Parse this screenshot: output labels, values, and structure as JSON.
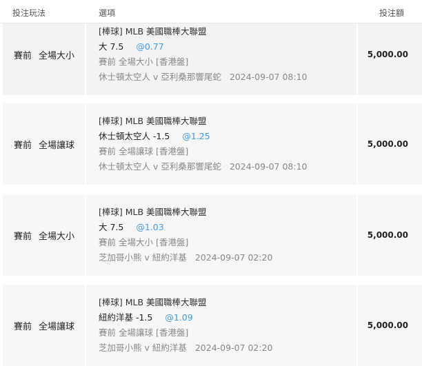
{
  "header": {
    "type_col": "投注玩法",
    "option_col": "選項",
    "amount_col": "投注額"
  },
  "bets": [
    {
      "phase": "賽前",
      "market": "全場大小",
      "league": "[棒球] MLB 美國職棒大聯盟",
      "selection": "大 7.5",
      "odds": "@0.77",
      "meta": "賽前 全場大小 [香港盤]",
      "match": "休士頓太空人 v 亞利桑那響尾蛇",
      "time": "2024-09-07 08:10",
      "amount": "5,000.00"
    },
    {
      "phase": "賽前",
      "market": "全場讓球",
      "league": "[棒球] MLB 美國職棒大聯盟",
      "selection": "休士頓太空人 -1.5",
      "odds": "@1.25",
      "meta": "賽前 全場讓球 [香港盤]",
      "match": "休士頓太空人 v 亞利桑那響尾蛇",
      "time": "2024-09-07 08:10",
      "amount": "5,000.00"
    },
    {
      "phase": "賽前",
      "market": "全場大小",
      "league": "[棒球] MLB 美國職棒大聯盟",
      "selection": "大 7.5",
      "odds": "@1.03",
      "meta": "賽前 全場大小 [香港盤]",
      "match": "芝加哥小熊 v 紐約洋基",
      "time": "2024-09-07 02:20",
      "amount": "5,000.00"
    },
    {
      "phase": "賽前",
      "market": "全場讓球",
      "league": "[棒球] MLB 美國職棒大聯盟",
      "selection": "紐約洋基 -1.5",
      "odds": "@1.09",
      "meta": "賽前 全場讓球 [香港盤]",
      "match": "芝加哥小熊 v 紐約洋基",
      "time": "2024-09-07 02:20",
      "amount": "5,000.00"
    }
  ]
}
